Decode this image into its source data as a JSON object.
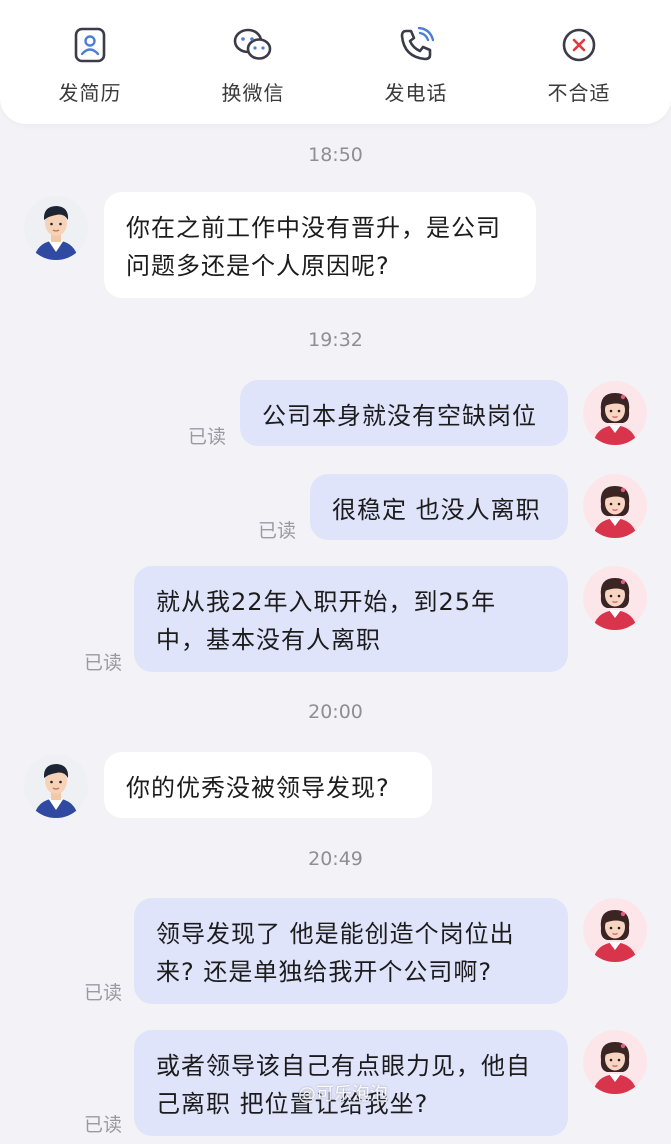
{
  "toolbar": {
    "items": [
      {
        "label": "发简历",
        "icon": "resume-icon"
      },
      {
        "label": "换微信",
        "icon": "wechat-icon"
      },
      {
        "label": "发电话",
        "icon": "phone-icon"
      },
      {
        "label": "不合适",
        "icon": "reject-icon"
      }
    ]
  },
  "chat": {
    "times": [
      "18:50",
      "19:32",
      "20:00",
      "20:49"
    ],
    "read_label": "已读",
    "messages": [
      {
        "from": "recruiter",
        "text": "你在之前工作中没有晋升，是公司\n问题多还是个人原因呢?"
      },
      {
        "from": "me",
        "text": "公司本身就没有空缺岗位"
      },
      {
        "from": "me",
        "text": "很稳定 也没人离职"
      },
      {
        "from": "me",
        "text": "就从我22年入职开始，到25年\n中，基本没有人离职"
      },
      {
        "from": "recruiter",
        "text": "你的优秀没被领导发现?"
      },
      {
        "from": "me",
        "text": "领导发现了 他是能创造个岗位出\n来? 还是单独给我开个公司啊?"
      },
      {
        "from": "me",
        "text": "或者领导该自己有点眼力见，他自\n己离职 把位置让给我坐?"
      }
    ]
  },
  "watermark": "@可乐泡泡",
  "colors": {
    "background": "#f3f3f7",
    "my_bubble": "#e0e4fb",
    "their_bubble": "#ffffff",
    "accent_blue": "#4d7dd6",
    "reject_red": "#e0393e"
  }
}
